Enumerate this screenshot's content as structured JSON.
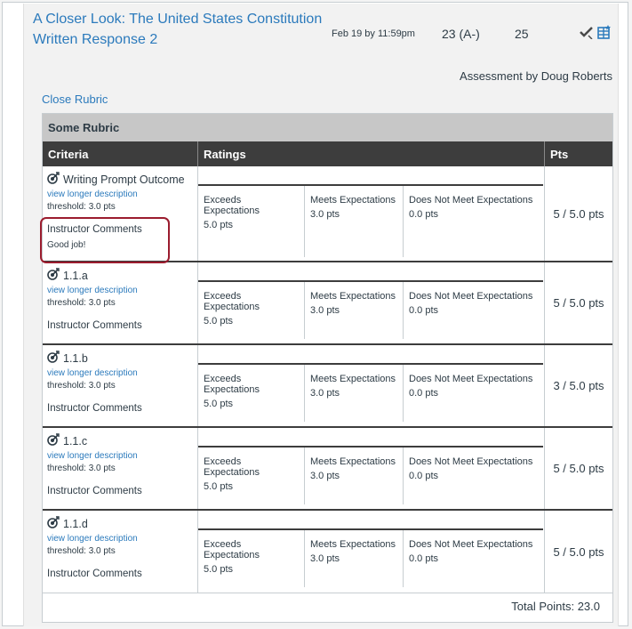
{
  "assignment": {
    "title": "A Closer Look: The United States Constitution Written Response 2",
    "due": "Feb 19 by 11:59pm",
    "score": "23 (A-)",
    "out_of": "25"
  },
  "assessment_by": "Assessment by Doug Roberts",
  "close_rubric_label": "Close Rubric",
  "rubric": {
    "title": "Some Rubric",
    "headers": {
      "criteria": "Criteria",
      "ratings": "Ratings",
      "pts": "Pts"
    },
    "rows": [
      {
        "name": "Writing Prompt Outcome",
        "link": "view longer description",
        "threshold": "threshold: 3.0 pts",
        "comments_label": "Instructor Comments",
        "comment": "Good job!",
        "ratings": [
          {
            "desc": "Exceeds Expectations",
            "pts": "5.0 pts"
          },
          {
            "desc": "Meets Expectations",
            "pts": "3.0 pts"
          },
          {
            "desc": "Does Not Meet Expectations",
            "pts": "0.0 pts"
          }
        ],
        "points": "5 / 5.0 pts"
      },
      {
        "name": "1.1.a",
        "link": "view longer description",
        "threshold": "threshold: 3.0 pts",
        "comments_label": "Instructor Comments",
        "ratings": [
          {
            "desc": "Exceeds Expectations",
            "pts": "5.0 pts"
          },
          {
            "desc": "Meets Expectations",
            "pts": "3.0 pts"
          },
          {
            "desc": "Does Not Meet Expectations",
            "pts": "0.0 pts"
          }
        ],
        "points": "5 / 5.0 pts"
      },
      {
        "name": "1.1.b",
        "link": "view longer description",
        "threshold": "threshold: 3.0 pts",
        "comments_label": "Instructor Comments",
        "ratings": [
          {
            "desc": "Exceeds Expectations",
            "pts": "5.0 pts"
          },
          {
            "desc": "Meets Expectations",
            "pts": "3.0 pts"
          },
          {
            "desc": "Does Not Meet Expectations",
            "pts": "0.0 pts"
          }
        ],
        "points": "3 / 5.0 pts"
      },
      {
        "name": "1.1.c",
        "link": "view longer description",
        "threshold": "threshold: 3.0 pts",
        "comments_label": "Instructor Comments",
        "ratings": [
          {
            "desc": "Exceeds Expectations",
            "pts": "5.0 pts"
          },
          {
            "desc": "Meets Expectations",
            "pts": "3.0 pts"
          },
          {
            "desc": "Does Not Meet Expectations",
            "pts": "0.0 pts"
          }
        ],
        "points": "5 / 5.0 pts"
      },
      {
        "name": "1.1.d",
        "link": "view longer description",
        "threshold": "threshold: 3.0 pts",
        "comments_label": "Instructor Comments",
        "ratings": [
          {
            "desc": "Exceeds Expectations",
            "pts": "5.0 pts"
          },
          {
            "desc": "Meets Expectations",
            "pts": "3.0 pts"
          },
          {
            "desc": "Does Not Meet Expectations",
            "pts": "0.0 pts"
          }
        ],
        "points": "5 / 5.0 pts"
      }
    ],
    "total": "Total Points: 23.0"
  },
  "icons": [
    "check-icon",
    "rubric-grid-icon",
    "outcome-target-icon"
  ],
  "colors": {
    "link": "#2b7abc",
    "header_bg": "#3d3d3d",
    "highlight": "#9b1c2e"
  }
}
